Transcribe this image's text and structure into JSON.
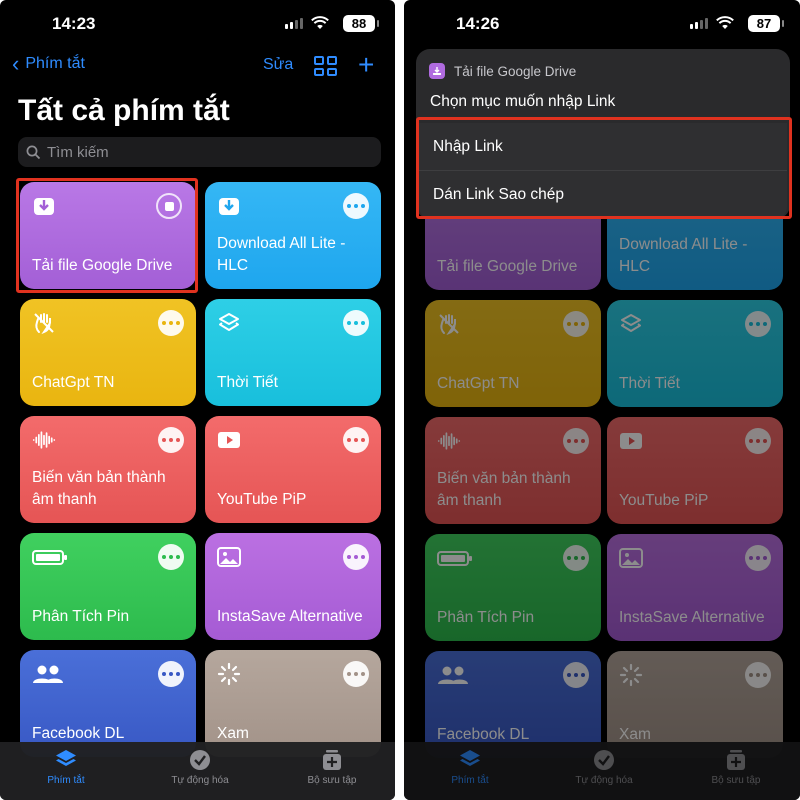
{
  "left": {
    "status": {
      "time": "14:23",
      "battery": "88"
    },
    "nav": {
      "back_label": "Phím tắt",
      "edit_label": "Sửa",
      "add_label": "+"
    },
    "title": "Tất cả phím tắt",
    "search": {
      "placeholder": "Tìm kiếm"
    },
    "tiles": [
      {
        "label": "Tải file Google Drive",
        "color": "#b06be0",
        "icon": "download-icon",
        "action": "stop"
      },
      {
        "label": "Download All Lite - HLC",
        "color": "#28aef0",
        "icon": "download-icon",
        "action": "more"
      },
      {
        "label": "ChatGpt TN",
        "color": "#edbd18",
        "icon": "hand-icon",
        "action": "more"
      },
      {
        "label": "Thời Tiết",
        "color": "#22c7e1",
        "icon": "layers-icon",
        "action": "more"
      },
      {
        "label": "Biến văn bản thành âm thanh",
        "color": "#ec6060",
        "icon": "waveform-icon",
        "action": "more"
      },
      {
        "label": "YouTube PiP",
        "color": "#ec6060",
        "icon": "play-icon",
        "action": "more"
      },
      {
        "label": "Phân Tích Pin",
        "color": "#36c656",
        "icon": "battery-icon",
        "action": "more"
      },
      {
        "label": "InstaSave Alternative",
        "color": "#b066db",
        "icon": "photo-icon",
        "action": "more"
      },
      {
        "label": "Facebook DL",
        "color": "#4163ce",
        "icon": "people-icon",
        "action": "more"
      },
      {
        "label": "Xam",
        "color": "#ab9c92",
        "icon": "sparkle-icon",
        "action": "more"
      }
    ],
    "tabs": [
      {
        "label": "Phím tắt",
        "icon": "layers-icon",
        "active": true
      },
      {
        "label": "Tự động hóa",
        "icon": "clock-check-icon",
        "active": false
      },
      {
        "label": "Bộ sưu tập",
        "icon": "gallery-icon",
        "active": false
      }
    ]
  },
  "right": {
    "status": {
      "time": "14:26",
      "battery": "87"
    },
    "menu": {
      "app_name": "Tải file Google Drive",
      "prompt": "Chọn mục muốn nhập Link",
      "options": [
        "Nhập Link",
        "Dán Link Sao chép"
      ]
    }
  },
  "colors": {
    "accent": "#2f8cff",
    "highlight": "#e0321f"
  }
}
